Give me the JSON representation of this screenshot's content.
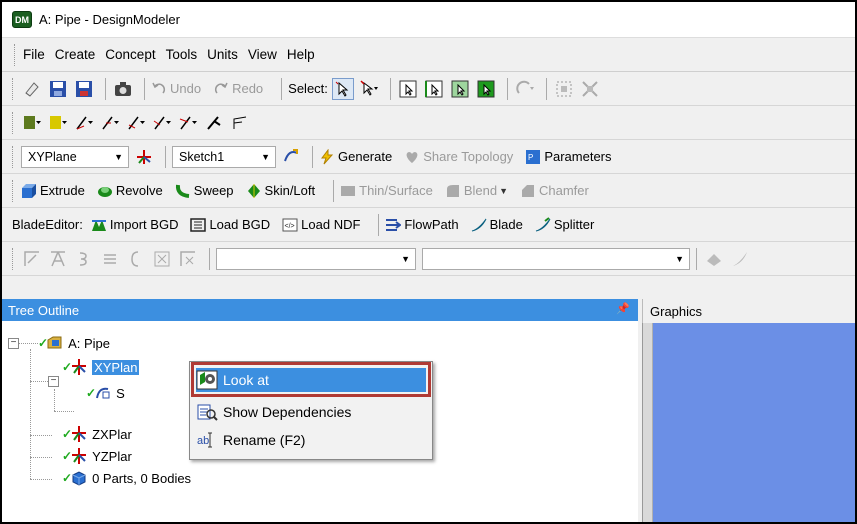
{
  "window": {
    "title": "A: Pipe - DesignModeler",
    "app_badge": "DM"
  },
  "menu": [
    "File",
    "Create",
    "Concept",
    "Tools",
    "Units",
    "View",
    "Help"
  ],
  "toolbar1": {
    "undo": "Undo",
    "redo": "Redo",
    "select_label": "Select:"
  },
  "toolbar3": {
    "plane_combo": "XYPlane",
    "sketch_combo": "Sketch1",
    "generate": "Generate",
    "share_topology": "Share Topology",
    "parameters": "Parameters"
  },
  "toolbar4": {
    "extrude": "Extrude",
    "revolve": "Revolve",
    "sweep": "Sweep",
    "skin_loft": "Skin/Loft",
    "thin_surface": "Thin/Surface",
    "blend": "Blend",
    "chamfer": "Chamfer"
  },
  "toolbar5": {
    "blade_editor": "BladeEditor:",
    "import_bgd": "Import BGD",
    "load_bgd": "Load BGD",
    "load_ndf": "Load NDF",
    "flowpath": "FlowPath",
    "blade": "Blade",
    "splitter": "Splitter"
  },
  "tree": {
    "header": "Tree Outline",
    "pin_icon": "pin-icon",
    "root": "A: Pipe",
    "xyplane": "XYPlan",
    "sketch_partial": "S",
    "zxplane": "ZXPlar",
    "yzplane": "YZPlar",
    "parts": "0 Parts, 0 Bodies"
  },
  "graphics": {
    "header": "Graphics"
  },
  "context_menu": {
    "items": [
      "Look at",
      "Show Dependencies",
      "Rename (F2)"
    ],
    "highlighted_index": 0,
    "highlight_color": "#b03a34"
  },
  "colors": {
    "selection": "#3c8fe0",
    "graphics_bg": "#6b8fe6",
    "check": "#1faa1f"
  }
}
